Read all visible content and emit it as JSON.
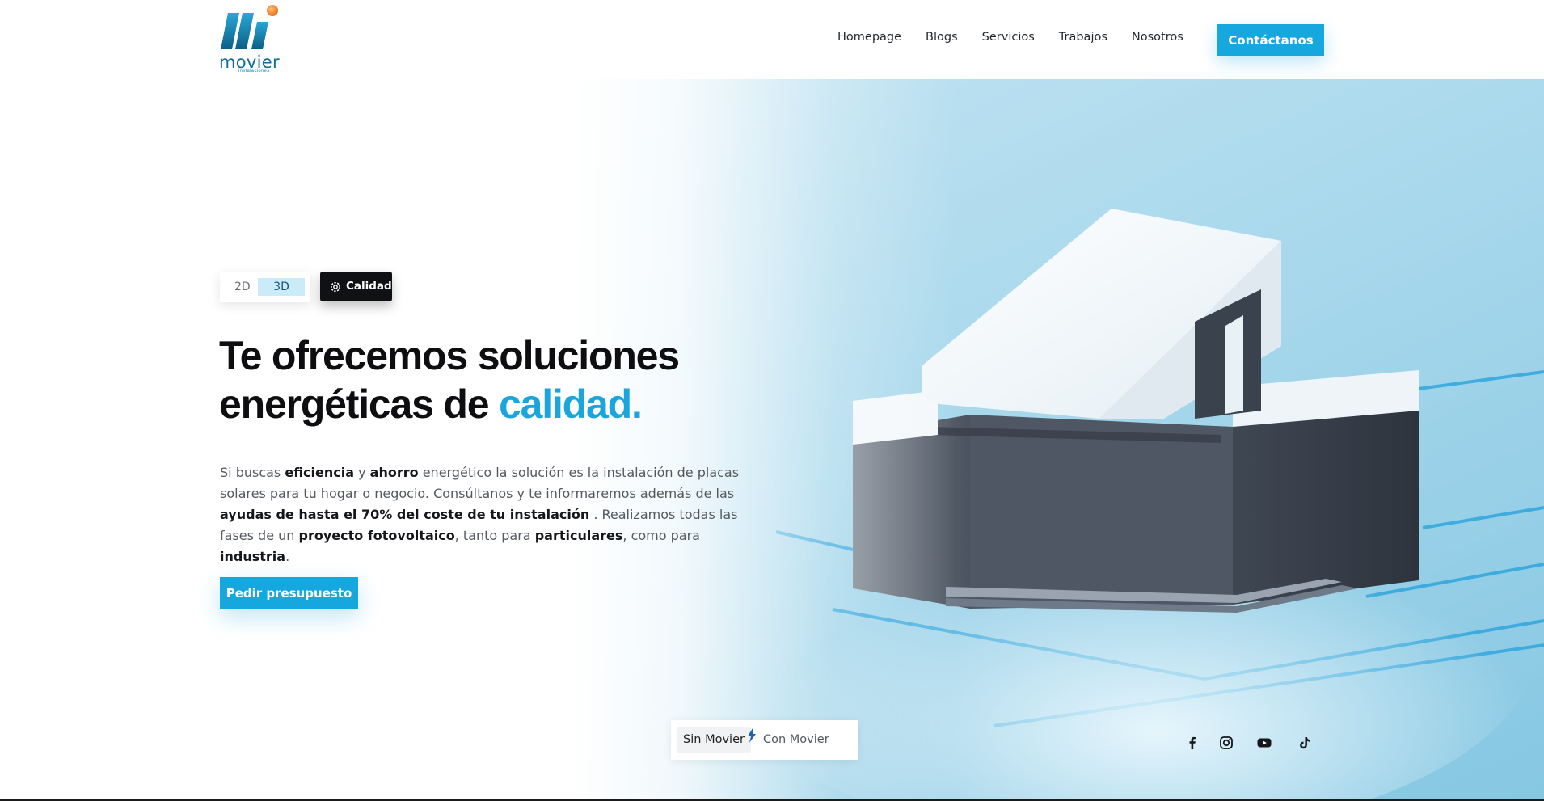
{
  "brand": {
    "name": "movier",
    "tagline": "instalaciones",
    "logo_icon": "movier-logo-mark"
  },
  "nav": {
    "items": [
      {
        "label": "Homepage"
      },
      {
        "label": "Blogs"
      },
      {
        "label": "Servicios"
      },
      {
        "label": "Trabajos"
      },
      {
        "label": "Nosotros"
      }
    ],
    "contact_label": "Contáctanos"
  },
  "hero": {
    "view_toggle": {
      "option_2d": "2D",
      "option_3d": "3D",
      "selected": "3D"
    },
    "badge": {
      "label": "Calidad",
      "icon": "gear-icon"
    },
    "headline": {
      "line1": "Te ofrecemos soluciones",
      "line2_prefix": "energéticas de ",
      "accent": "calidad."
    },
    "description": [
      {
        "text": "Si buscas ",
        "bold": false
      },
      {
        "text": "eficiencia",
        "bold": true
      },
      {
        "text": " y ",
        "bold": false
      },
      {
        "text": "ahorro",
        "bold": true
      },
      {
        "text": " energético la solución es la instalación de placas solares para tu hogar o negocio. Consúltanos y te informaremos además de las ",
        "bold": false
      },
      {
        "text": "ayudas de hasta el 70% del coste de tu instalación",
        "bold": true
      },
      {
        "text": " . Realizamos todas las fases de un ",
        "bold": false
      },
      {
        "text": "proyecto fotovoltaico",
        "bold": true
      },
      {
        "text": ", tanto para ",
        "bold": false
      },
      {
        "text": "particulares",
        "bold": true
      },
      {
        "text": ", como para ",
        "bold": false
      },
      {
        "text": "industria",
        "bold": true
      },
      {
        "text": ".",
        "bold": false
      }
    ],
    "cta_label": "Pedir presupuesto",
    "comparison": {
      "without": "Sin Movier",
      "with": "Con Movier",
      "selected": "Sin Movier",
      "with_icon": "lightning-bolt-icon"
    }
  },
  "social": [
    "facebook-icon",
    "instagram-icon",
    "youtube-icon",
    "tiktok-icon"
  ],
  "colors": {
    "accent": "#16a7df",
    "dark": "#0f1115",
    "hero_sky": "#8ccbe4"
  }
}
